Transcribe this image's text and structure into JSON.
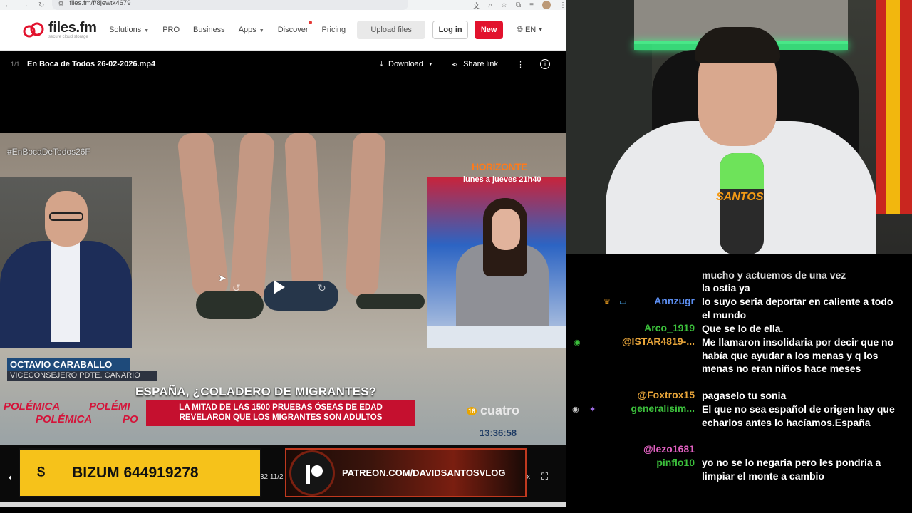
{
  "browser": {
    "url": "files.fm/f/8jewtk4679"
  },
  "site": {
    "logo_name": "files.fm",
    "logo_tagline": "secure cloud storage",
    "menu": [
      {
        "label": "Solutions",
        "has_caret": true
      },
      {
        "label": "PRO",
        "has_caret": false
      },
      {
        "label": "Business",
        "has_caret": false
      },
      {
        "label": "Apps",
        "has_caret": true
      },
      {
        "label": "Discover",
        "has_caret": false
      },
      {
        "label": "Pricing",
        "has_caret": false
      }
    ],
    "upload_label": "Upload files",
    "login_label": "Log in",
    "new_label": "New",
    "language": "EN"
  },
  "player": {
    "file_count": "1/1",
    "file_name": "En Boca de Todos 26-02-2026.mp4",
    "download_label": "Download",
    "share_label": "Share link",
    "time_partial": "32:11/2",
    "close_partial": "x"
  },
  "video": {
    "hashtag": "#EnBocaDeTodos26F",
    "promo_title": "HORIZONTE",
    "promo_schedule": "lunes a jueves 21h40",
    "guest_name": "OCTAVIO CARABALLO",
    "guest_role": "VICECONSEJERO PDTE. CANARIO",
    "headline": "ESPAÑA, ¿COLADERO DE MIGRANTES?",
    "subheadline_1": "LA MITAD DE LAS 1500 PRUEBAS ÓSEAS DE EDAD",
    "subheadline_2": "REVELARON QUE LOS MIGRANTES SON ADULTOS",
    "polemica_words": [
      "POLÉMICA",
      "POLÉMI",
      "POLÉMICA",
      "PO"
    ],
    "channel": "cuatro",
    "channel_number": "16",
    "clock": "13:36:58"
  },
  "overlays": {
    "bizum_sign": "$",
    "bizum_text": "BIZUM 644919278",
    "patreon_text": "PATREON.COM/DAVIDSANTOSVLOG"
  },
  "webcam": {
    "mic_brand": "SANTOS"
  },
  "chat": {
    "messages": [
      {
        "user": "",
        "user_color": "#ffffff",
        "text": "mucho y actuemos de una vez",
        "badges": []
      },
      {
        "user": "",
        "user_color": "#ffffff",
        "text": "la ostia ya",
        "badges": []
      },
      {
        "user": "Annzugr",
        "user_color": "#5b8def",
        "text": "lo suyo seria deportar en caliente a todo el mundo",
        "badges": [
          "crown",
          "tv"
        ]
      },
      {
        "user": "Arco_1919",
        "user_color": "#3cc13c",
        "text": "Que se lo de ella.",
        "badges": []
      },
      {
        "user": "@ISTAR4819-...",
        "user_color": "#e8a53a",
        "text": "Me llamaron insolidaria por decir que no había que ayudar a los menas y q los menas no eran niños hace meses",
        "badges": [
          "eye"
        ]
      },
      {
        "user": "@Foxtrox15",
        "user_color": "#e8a53a",
        "text": "pagaselo tu sonia",
        "badges": []
      },
      {
        "user": "generalisim...",
        "user_color": "#3cc13c",
        "text": "El que no sea español de origen hay que echarlos antes lo hacíamos.España",
        "badges": [
          "eye",
          "sub"
        ]
      },
      {
        "user": "@lezo1681",
        "user_color": "#e060c0",
        "text": "yo no se lo negaria pero les pondria a limpiar el monte a cambio",
        "badges": []
      },
      {
        "user": "pinflo10",
        "user_color": "#3cc13c",
        "text": "",
        "badges": []
      }
    ]
  }
}
